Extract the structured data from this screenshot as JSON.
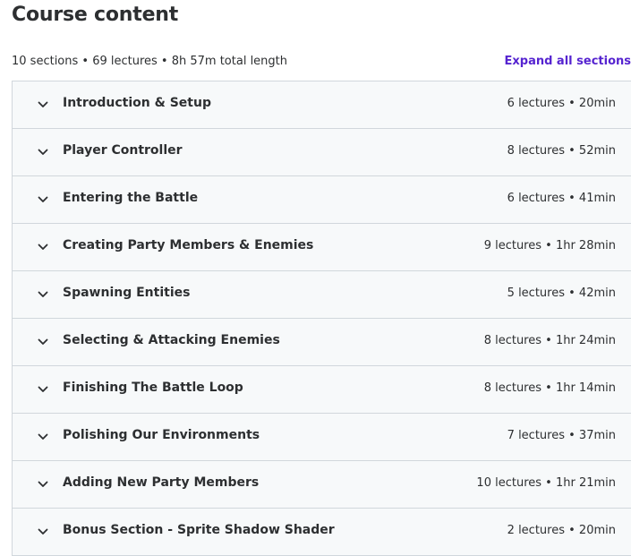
{
  "header": {
    "title": "Course content",
    "summary": "10 sections • 69 lectures • 8h 57m total length",
    "expand_label": "Expand all sections"
  },
  "sections": [
    {
      "title": "Introduction & Setup",
      "meta": "6 lectures • 20min",
      "icon": "chevron-down-icon"
    },
    {
      "title": "Player Controller",
      "meta": "8 lectures • 52min",
      "icon": "chevron-down-icon"
    },
    {
      "title": "Entering the Battle",
      "meta": "6 lectures • 41min",
      "icon": "chevron-down-icon"
    },
    {
      "title": "Creating Party Members & Enemies",
      "meta": "9 lectures • 1hr 28min",
      "icon": "chevron-down-icon"
    },
    {
      "title": "Spawning Entities",
      "meta": "5 lectures • 42min",
      "icon": "chevron-down-icon"
    },
    {
      "title": "Selecting & Attacking Enemies",
      "meta": "8 lectures • 1hr 24min",
      "icon": "chevron-down-icon"
    },
    {
      "title": "Finishing The Battle Loop",
      "meta": "8 lectures • 1hr 14min",
      "icon": "chevron-down-icon"
    },
    {
      "title": "Polishing Our Environments",
      "meta": "7 lectures • 37min",
      "icon": "chevron-down-icon"
    },
    {
      "title": "Adding New Party Members",
      "meta": "10 lectures • 1hr 21min",
      "icon": "chevron-down-icon"
    },
    {
      "title": "Bonus Section - Sprite Shadow Shader",
      "meta": "2 lectures • 20min",
      "icon": "chevron-down-icon"
    }
  ],
  "colors": {
    "accent": "#5624d0",
    "row_background": "#f7f9fa",
    "border": "#d1d7dc",
    "text": "#2d2f31"
  }
}
